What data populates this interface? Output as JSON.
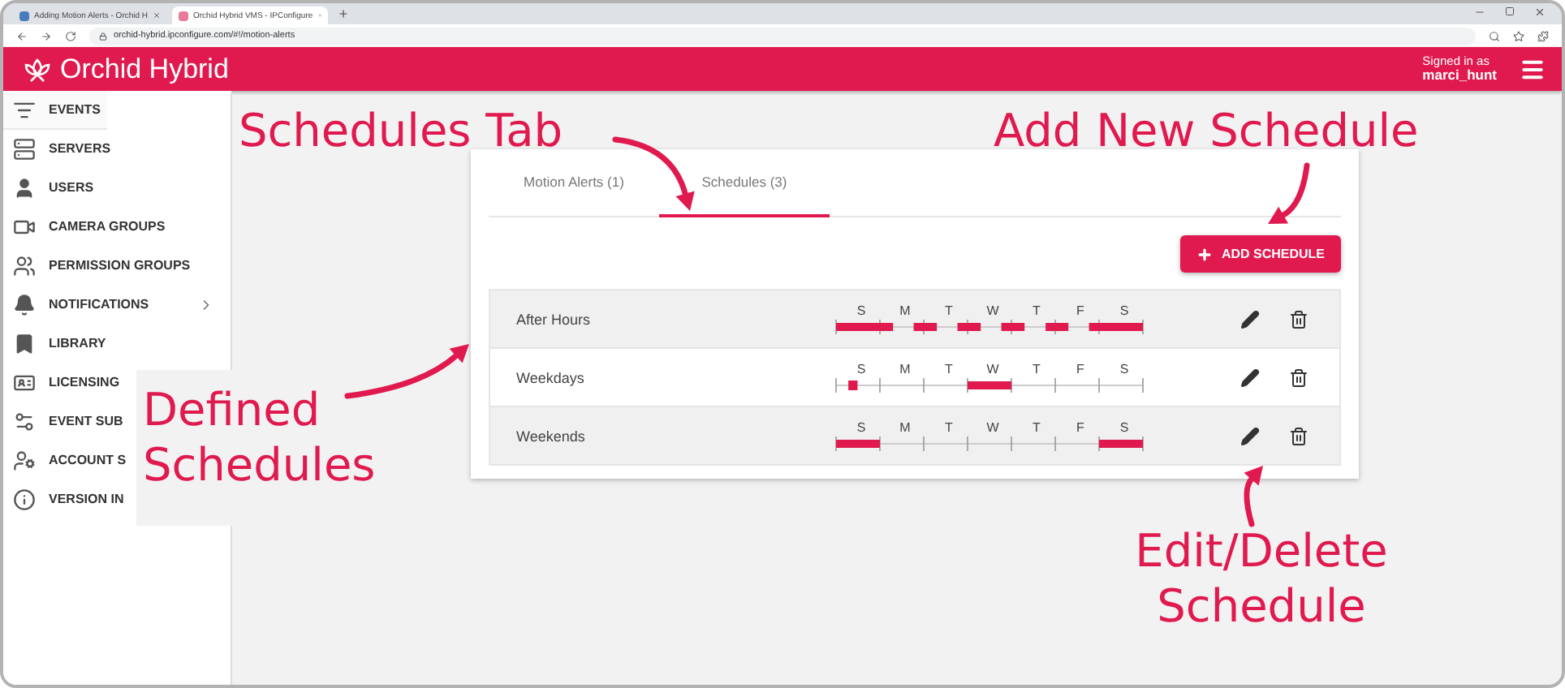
{
  "browser": {
    "tabs": [
      {
        "title": "Adding Motion Alerts - Orchid H",
        "selected": false
      },
      {
        "title": "Orchid Hybrid VMS - IPConfigure",
        "selected": true
      }
    ],
    "url": "orchid-hybrid.ipconfigure.com/#!/motion-alerts"
  },
  "header": {
    "title": "Orchid Hybrid",
    "signed_in_label": "Signed in as",
    "username": "marci_hunt"
  },
  "sidebar": {
    "items": [
      {
        "label": "EVENTS",
        "kind": "events",
        "selected": true,
        "has_submenu": false
      },
      {
        "label": "SERVERS",
        "kind": "servers",
        "selected": false,
        "has_submenu": false
      },
      {
        "label": "USERS",
        "kind": "users",
        "selected": false,
        "has_submenu": false
      },
      {
        "label": "CAMERA GROUPS",
        "kind": "cameras",
        "selected": false,
        "has_submenu": false
      },
      {
        "label": "PERMISSION GROUPS",
        "kind": "permissions",
        "selected": false,
        "has_submenu": false
      },
      {
        "label": "NOTIFICATIONS",
        "kind": "notifications",
        "selected": false,
        "has_submenu": true
      },
      {
        "label": "LIBRARY",
        "kind": "library",
        "selected": false,
        "has_submenu": false
      },
      {
        "label": "LICENSING",
        "kind": "licensing",
        "selected": false,
        "has_submenu": false
      },
      {
        "label": "EVENT SUB",
        "kind": "subscriptions",
        "selected": false,
        "has_submenu": false
      },
      {
        "label": "ACCOUNT S",
        "kind": "account",
        "selected": false,
        "has_submenu": false
      },
      {
        "label": "VERSION IN",
        "kind": "version",
        "selected": false,
        "has_submenu": false
      }
    ]
  },
  "tabs": [
    {
      "label": "Motion Alerts (1)",
      "selected": false
    },
    {
      "label": "Schedules (3)",
      "selected": true
    }
  ],
  "add_button": "ADD SCHEDULE",
  "schedules": [
    {
      "name": "After Hours",
      "kind": "after-hours",
      "days": [
        "S",
        "M",
        "T",
        "W",
        "T",
        "F",
        "S"
      ]
    },
    {
      "name": "Weekdays",
      "kind": "weekdays",
      "days": [
        "S",
        "M",
        "T",
        "W",
        "T",
        "F",
        "S"
      ]
    },
    {
      "name": "Weekends",
      "kind": "weekends",
      "days": [
        "S",
        "M",
        "T",
        "W",
        "T",
        "F",
        "S"
      ]
    }
  ],
  "annotations": [
    {
      "kind": "schedules-tab",
      "text": "Schedules Tab"
    },
    {
      "kind": "add-schedule",
      "text": "Add New Schedule"
    },
    {
      "kind": "defined-schedules",
      "text": "Defined Schedules"
    },
    {
      "kind": "edit-delete",
      "text": "Edit/Delete Schedule"
    }
  ]
}
